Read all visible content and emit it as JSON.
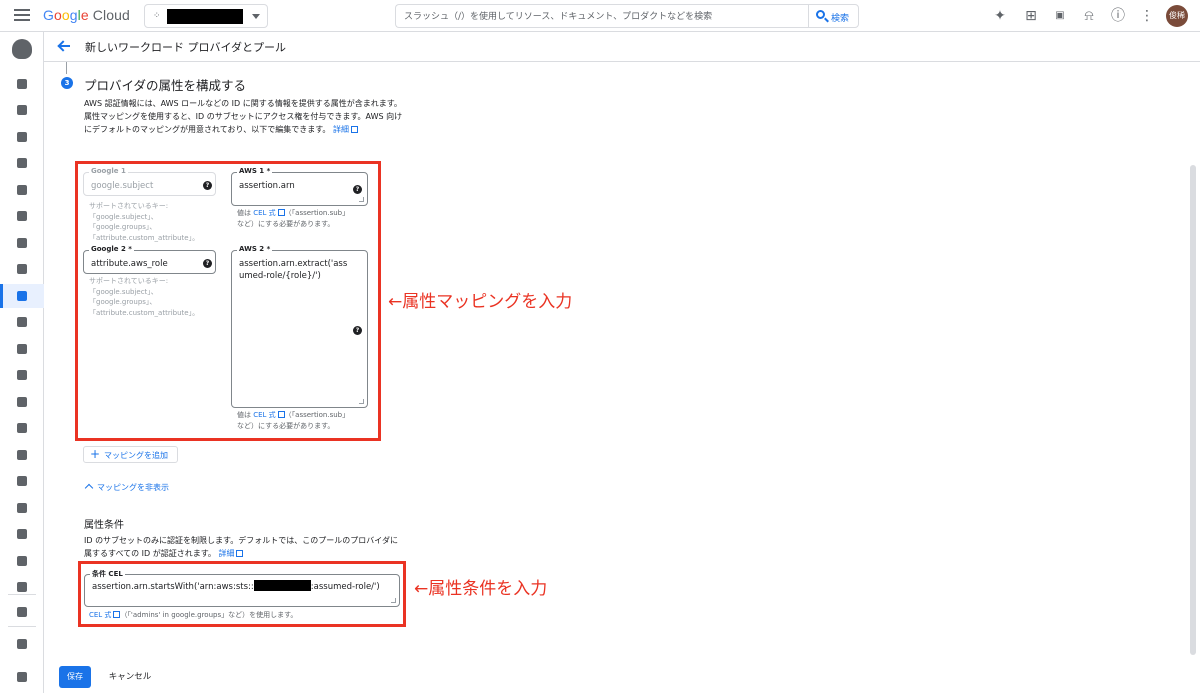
{
  "app": {
    "logo_google": "Google",
    "logo_cloud": "Cloud"
  },
  "search": {
    "placeholder": "スラッシュ（/）を使用してリソース、ドキュメント、プロダクトなどを検索",
    "button_label": "検索"
  },
  "user": {
    "avatar_text": "俊稀"
  },
  "page": {
    "title": "新しいワークロード プロバイダとプール"
  },
  "step": {
    "number": "3",
    "title": "プロバイダの属性を構成する",
    "description": "AWS 認証情報には、AWS ロールなどの ID に関する情報を提供する属性が含まれます。属性マッピングを使用すると、ID のサブセットにアクセス権を付与できます。AWS 向けにデフォルトのマッピングが用意されており、以下で編集できます。",
    "details_link": "詳細"
  },
  "mappings": [
    {
      "google_label": "Google 1",
      "google_value": "google.subject",
      "google_hint": [
        "サポートされているキー:",
        "「google.subject」、",
        "「google.groups」、",
        "「attribute.custom_attribute」。"
      ],
      "aws_label": "AWS 1 *",
      "aws_value": "assertion.arn",
      "aws_hint_prefix": "値は",
      "aws_hint_link": "CEL 式",
      "aws_hint_suffix": "（「assertion.sub」",
      "aws_hint_line2": "など）にする必要があります。"
    },
    {
      "google_label": "Google 2 *",
      "google_value": "attribute.aws_role",
      "google_hint": [
        "サポートされているキー:",
        "「google.subject」、",
        "「google.groups」、",
        "「attribute.custom_attribute」。"
      ],
      "aws_label": "AWS 2 *",
      "aws_value_line1": "assertion.arn.extract('ass",
      "aws_value_line2": "umed-role/{role}/')",
      "aws_hint_prefix": "値は",
      "aws_hint_link": "CEL 式",
      "aws_hint_suffix": "（「assertion.sub」",
      "aws_hint_line2": "など）にする必要があります。"
    }
  ],
  "add_mapping_label": "マッピングを追加",
  "hide_mapping_label": "マッピングを非表示",
  "conditions": {
    "title": "属性条件",
    "description": "ID のサブセットのみに認証を制限します。デフォルトでは、このプールのプロバイダに属するすべての ID が認証されます。",
    "details_link": "詳細",
    "field_label": "条件 CEL",
    "value_prefix": "assertion.arn.startsWith('arn:aws:sts::",
    "value_suffix": ":assumed-role/')",
    "hint_link": "CEL 式",
    "hint_text": "（「'admins' in google.groups」など）を使用します。"
  },
  "annotations": {
    "mapping": "←属性マッピングを入力",
    "condition": "←属性条件を入力"
  },
  "footer": {
    "save_label": "保存",
    "cancel_label": "キャンセル"
  },
  "colors": {
    "accent": "#1a73e8",
    "annotation_red": "#ea3323"
  }
}
